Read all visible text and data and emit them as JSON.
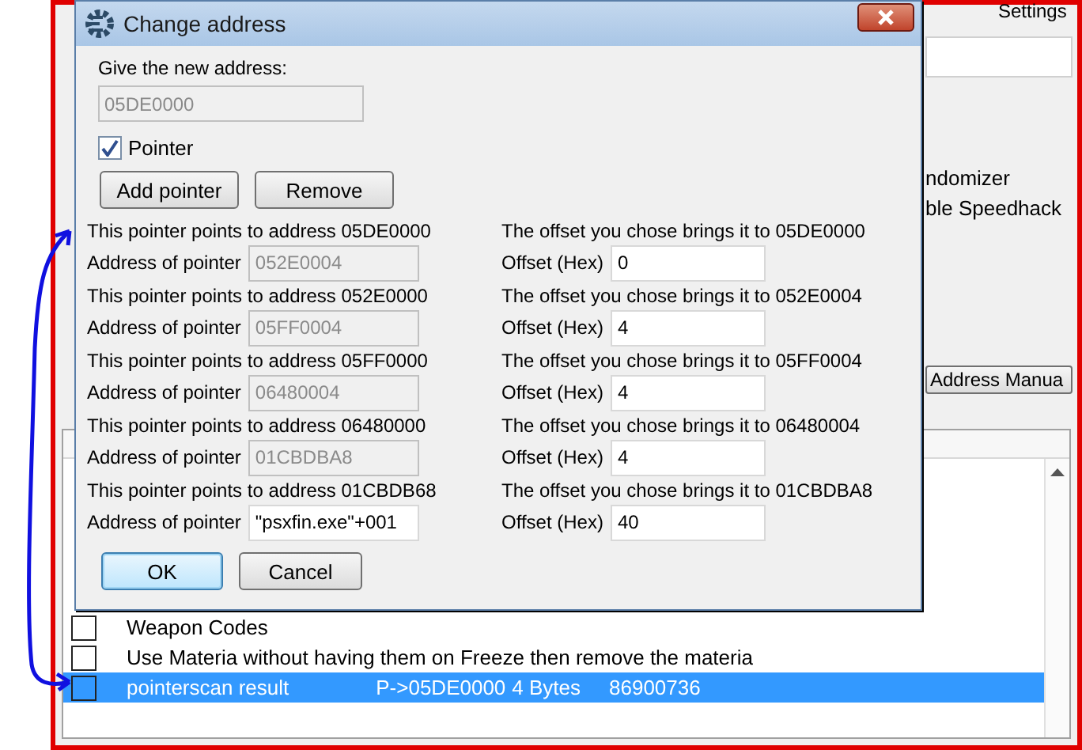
{
  "background": {
    "settings_label": "Settings",
    "options": [
      "ndomizer",
      "ble Speedhack"
    ],
    "add_address_button": "Address Manua",
    "table": {
      "rows": [
        {
          "checked": false,
          "selected": false,
          "description": "Weapon Codes"
        },
        {
          "checked": false,
          "selected": false,
          "description": "Use Materia without having them on Freeze then remove the materia"
        },
        {
          "checked": false,
          "selected": true,
          "description": "pointerscan result",
          "address": "P->05DE0000",
          "type": "4 Bytes",
          "value": "86900736"
        }
      ]
    }
  },
  "dialog": {
    "title": "Change address",
    "address_label": "Give the new address:",
    "address_value": "05DE0000",
    "pointer_checkbox": {
      "label": "Pointer",
      "checked": true
    },
    "top_buttons": [
      "Add pointer",
      "Remove"
    ],
    "levels": [
      {
        "points_to": "This pointer points to address 05DE0000",
        "brings_to": "The offset you chose brings it to 05DE0000",
        "address_label": "Address of pointer",
        "address_value": "052E0004",
        "address_disabled": true,
        "offset_label": "Offset (Hex)",
        "offset_value": "0"
      },
      {
        "points_to": "This pointer points to address 052E0000",
        "brings_to": "The offset you chose brings it to 052E0004",
        "address_label": "Address of pointer",
        "address_value": "05FF0004",
        "address_disabled": true,
        "offset_label": "Offset (Hex)",
        "offset_value": "4"
      },
      {
        "points_to": "This pointer points to address 05FF0000",
        "brings_to": "The offset you chose brings it to 05FF0004",
        "address_label": "Address of pointer",
        "address_value": "06480004",
        "address_disabled": true,
        "offset_label": "Offset (Hex)",
        "offset_value": "4"
      },
      {
        "points_to": "This pointer points to address 06480000",
        "brings_to": "The offset you chose brings it to 06480004",
        "address_label": "Address of pointer",
        "address_value": "01CBDBA8",
        "address_disabled": true,
        "offset_label": "Offset (Hex)",
        "offset_value": "4"
      },
      {
        "points_to": "This pointer points to address 01CBDB68",
        "brings_to": "The offset you chose brings it to 01CBDBA8",
        "address_label": "Address of pointer",
        "address_value": "\"psxfin.exe\"+001",
        "address_disabled": false,
        "offset_label": "Offset (Hex)",
        "offset_value": "40"
      }
    ],
    "buttons": [
      {
        "label": "OK",
        "default": true
      },
      {
        "label": "Cancel",
        "default": false
      }
    ]
  }
}
